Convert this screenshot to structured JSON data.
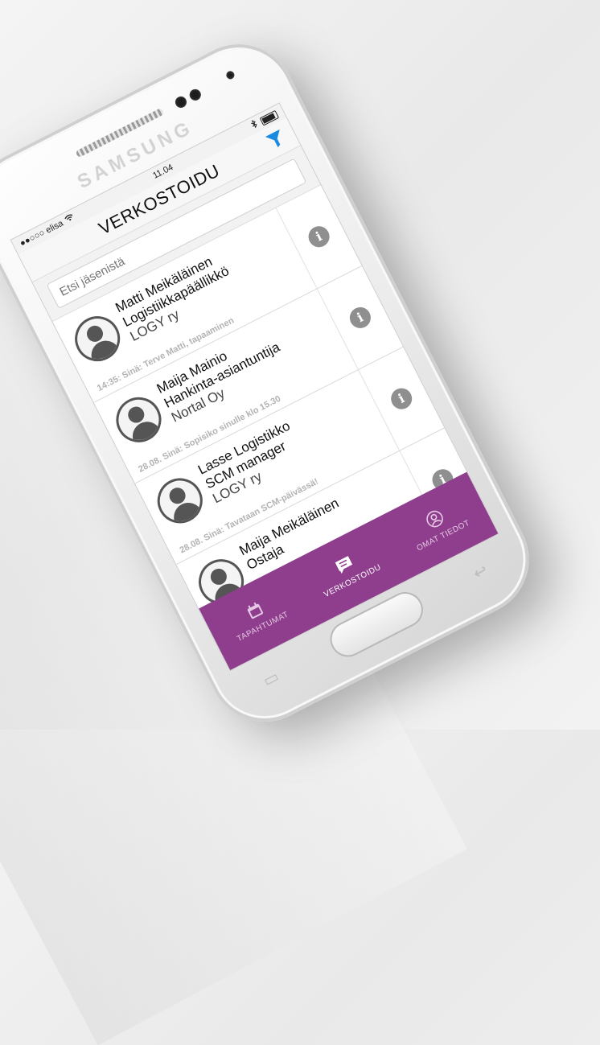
{
  "device": {
    "brand": "SAMSUNG"
  },
  "status_bar": {
    "carrier": "●●○○○ elisa",
    "time": "11.04"
  },
  "header": {
    "title": "VERKOSTOIDU",
    "filter_icon": "filter-icon"
  },
  "search": {
    "placeholder": "Etsi jäsenistä"
  },
  "contacts": [
    {
      "name": "Matti Meikäläinen",
      "title": "Logistiikkapäällikkö",
      "org": "LOGY ry",
      "last_message": "14:35: Sinä: Terve Matti, tapaaminen"
    },
    {
      "name": "Maija Mainio",
      "title": "Hankinta-asiantuntija",
      "org": "Nortal Oy",
      "last_message": "28.08. Sinä: Sopisiko sinulle klo 15.30"
    },
    {
      "name": "Lasse Logistikko",
      "title": "SCM manager",
      "org": "LOGY ry",
      "last_message": "28.08. Sinä: Tavataan SCM-päivässä!"
    },
    {
      "name": "Maija Meikäläinen",
      "title": "Ostaja",
      "org": "",
      "last_message": ""
    }
  ],
  "tabbar": {
    "items": [
      {
        "label": "TAPAHTUMAT",
        "icon": "calendar-icon"
      },
      {
        "label": "VERKOSTOIDU",
        "icon": "chat-icon"
      },
      {
        "label": "OMAT TIEDOT",
        "icon": "profile-icon"
      }
    ]
  },
  "colors": {
    "accent": "#8e3e8c",
    "filter": "#1a8be0",
    "info": "#8f8f8f"
  }
}
